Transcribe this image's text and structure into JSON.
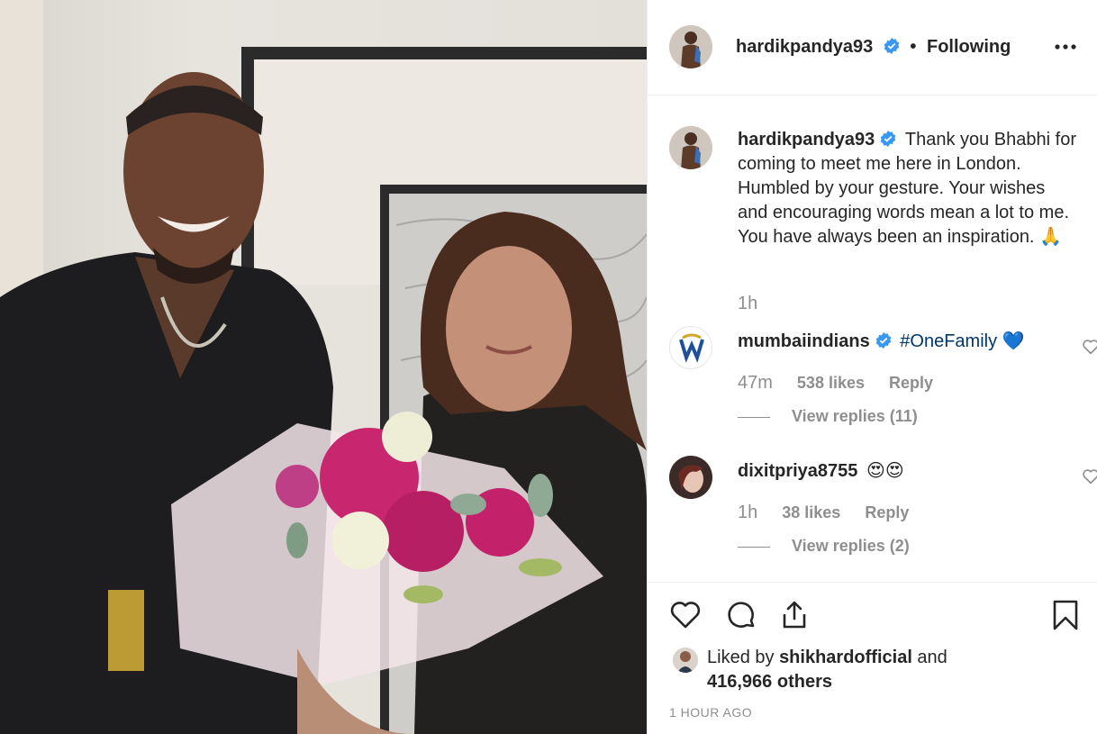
{
  "post": {
    "author": "hardikpandya93",
    "separator": "•",
    "follow_status": "Following"
  },
  "caption": {
    "author": "hardikpandya93",
    "text": "Thank you Bhabhi for coming to meet me here in London. Humbled by your gesture. Your wishes and encouraging words mean a lot to me. You have always been an inspiration. 🙏",
    "time": "1h"
  },
  "comments": [
    {
      "author": "mumbaiindians",
      "text": "#OneFamily 💙",
      "time": "47m",
      "likes": "538 likes",
      "reply": "Reply",
      "view_replies": "View replies (11)"
    },
    {
      "author": "dixitpriya8755",
      "text": "😍😍",
      "time": "1h",
      "likes": "38 likes",
      "reply": "Reply",
      "view_replies": "View replies (2)"
    }
  ],
  "likes": {
    "prefix": "Liked by ",
    "user": "shikhardofficial",
    "suffix": " and",
    "others": "416,966 others"
  },
  "timestamp": "1 HOUR AGO",
  "icons": [
    "verified-icon",
    "more-options-icon",
    "heart-icon",
    "comment-icon",
    "share-icon",
    "bookmark-icon"
  ],
  "colors": {
    "verified": "#3897f0",
    "text": "#262626",
    "muted": "#8e8e8e",
    "hashtag": "#00376b"
  }
}
